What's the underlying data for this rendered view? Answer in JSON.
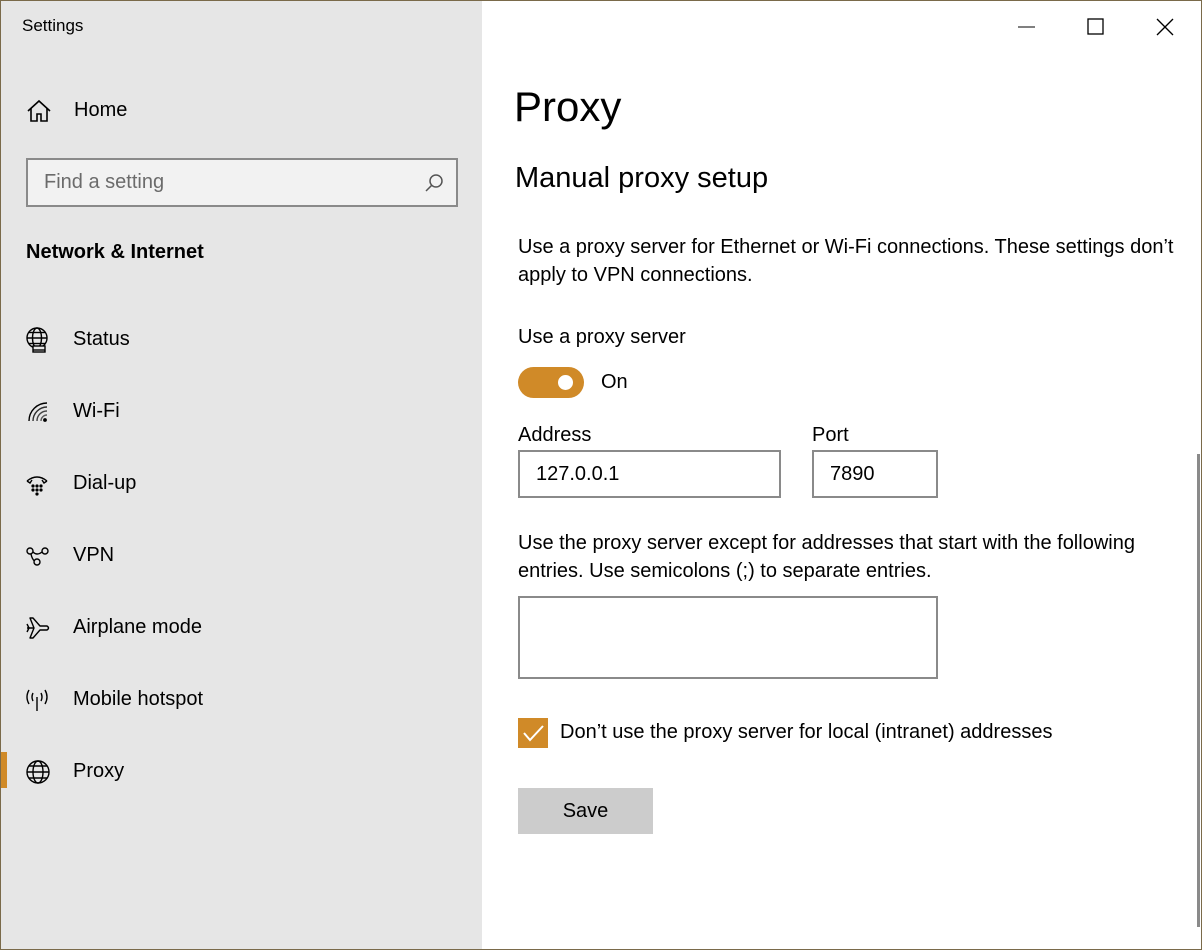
{
  "window": {
    "title": "Settings",
    "accent": "#d08a28",
    "controls": [
      "minimize-icon",
      "maximize-icon",
      "close-icon"
    ]
  },
  "sidebar": {
    "home_label": "Home",
    "search_placeholder": "Find a setting",
    "section_title": "Network & Internet",
    "items": [
      {
        "label": "Status",
        "icon": "globe-status-icon",
        "active": false
      },
      {
        "label": "Wi-Fi",
        "icon": "wifi-icon",
        "active": false
      },
      {
        "label": "Dial-up",
        "icon": "dialup-icon",
        "active": false
      },
      {
        "label": "VPN",
        "icon": "vpn-icon",
        "active": false
      },
      {
        "label": "Airplane mode",
        "icon": "airplane-icon",
        "active": false
      },
      {
        "label": "Mobile hotspot",
        "icon": "hotspot-icon",
        "active": false
      },
      {
        "label": "Proxy",
        "icon": "globe-icon",
        "active": true
      }
    ]
  },
  "main": {
    "page_title": "Proxy",
    "section_heading": "Manual proxy setup",
    "description": "Use a proxy server for Ethernet or Wi-Fi connections. These settings don’t apply to VPN connections.",
    "use_proxy_label": "Use a proxy server",
    "toggle_state": "On",
    "address_label": "Address",
    "address_value": "127.0.0.1",
    "port_label": "Port",
    "port_value": "7890",
    "exceptions_text": "Use the proxy server except for addresses that start with the following entries. Use semicolons (;) to separate entries.",
    "exceptions_value": "",
    "local_checkbox_label": "Don’t use the proxy server for local (intranet) addresses",
    "local_checkbox_checked": true,
    "save_label": "Save"
  }
}
